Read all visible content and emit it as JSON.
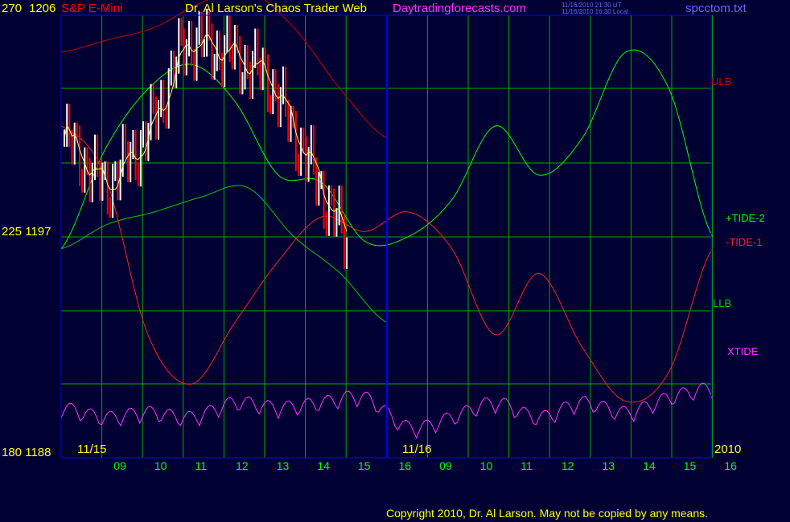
{
  "header": {
    "y_left_top": "270",
    "price_top": "1206",
    "symbol": "S&P E-Mini",
    "title": "Dr. Al Larson's Chaos Trader Web",
    "site": "Daytradingforecasts.com",
    "time_ut": "11/16/2010 21:30 UT",
    "time_local": "11/16/2010 16:30 Local",
    "file": "spcctom.txt"
  },
  "colors": {
    "background": "#000033",
    "grid": "#00aa00",
    "ulb": "#cc0000",
    "llb": "#00cc00",
    "tide2": "#00ff00",
    "tide1": "#ff2020",
    "xtide": "#ff33ff",
    "bar_up": "#ffffff",
    "bar_down": "#ff0000",
    "now_line": "#0000ff"
  },
  "left_axis": [
    {
      "label": "270  1206",
      "level": "top"
    },
    {
      "label": "225  1197",
      "level": "mid"
    },
    {
      "label": "180  1188",
      "level": "bottom"
    }
  ],
  "x_labels": {
    "hours": [
      "09",
      "10",
      "11",
      "12",
      "13",
      "14",
      "15",
      "16",
      "09",
      "10",
      "11",
      "12",
      "13",
      "14",
      "15",
      "16"
    ],
    "dates": [
      "11/15",
      "11/16"
    ],
    "year": "2010"
  },
  "right_labels": [
    {
      "key": "ulb",
      "text": "ULB"
    },
    {
      "key": "tide2",
      "text": "+TIDE-2"
    },
    {
      "key": "tide1",
      "text": "-TIDE-1"
    },
    {
      "key": "llb",
      "text": "LLB"
    },
    {
      "key": "xtide",
      "text": "XTIDE"
    }
  ],
  "footer": "Copyright 2010, Dr. Al Larson. May not be copied by any means.",
  "chart_data": {
    "type": "line",
    "y_left_range": [
      180,
      270
    ],
    "price_range": [
      1188,
      1206
    ],
    "x": [
      "11/15 09",
      "11/15 10",
      "11/15 11",
      "11/15 12",
      "11/15 13",
      "11/15 14",
      "11/15 15",
      "11/15 16",
      "11/16 09",
      "11/16 10",
      "11/16 11",
      "11/16 12",
      "11/16 13",
      "11/16 14",
      "11/16 15",
      "11/16 16"
    ],
    "series": [
      {
        "name": "ULB",
        "color": "#cc0000",
        "values": [
          1204.5,
          1205,
          1205.5,
          1206.5,
          1207,
          1205.5,
          1203,
          1201
        ]
      },
      {
        "name": "LLB",
        "color": "#00cc00",
        "values": [
          1196.5,
          1197.5,
          1198,
          1198.6,
          1199,
          1197,
          1195.5,
          1193.5
        ]
      },
      {
        "name": "+TIDE-2",
        "color": "#00ff00",
        "values": [
          1196.5,
          1200.5,
          1203,
          1204,
          1202.5,
          1199.5,
          1199.2,
          1196.8,
          1197,
          1198.5,
          1201.5,
          1199.5,
          1201,
          1204.5,
          1203,
          1197
        ]
      },
      {
        "name": "-TIDE-1",
        "color": "#ff2020",
        "values": [
          1201.5,
          1199.5,
          1193,
          1191,
          1193.5,
          1196,
          1197.8,
          1197.2,
          1198,
          1196.5,
          1193,
          1195.5,
          1192.5,
          1190.3,
          1191.5,
          1196.5
        ]
      },
      {
        "name": "XTIDE",
        "color": "#ff33ff",
        "values": [
          188,
          186,
          187,
          186,
          189,
          188,
          189,
          190,
          184,
          186,
          189,
          186,
          189,
          187,
          190,
          192
        ]
      },
      {
        "name": "S&P E-Mini",
        "color": "#ffffff",
        "values": [
          1201,
          1199,
          1201,
          1205,
          1204.5,
          1203.5,
          1200,
          1196.5
        ]
      }
    ]
  }
}
